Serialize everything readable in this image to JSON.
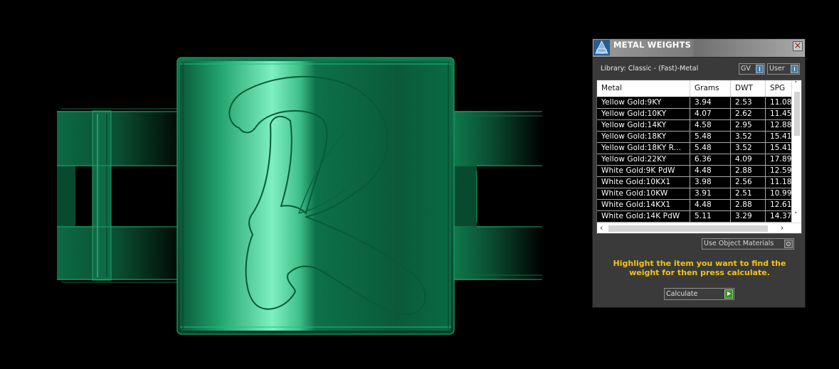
{
  "dialog": {
    "title": "METAL WEIGHTS",
    "close_label": "×",
    "library_label": "Library: Classic - (Fast)-Metal",
    "toggles": {
      "gv": "GV",
      "user": "User"
    },
    "columns": [
      "Metal",
      "Grams",
      "DWT",
      "SPG"
    ],
    "rows": [
      {
        "metal": "Yellow Gold:9KY",
        "grams": "3.94",
        "dwt": "2.53",
        "spg": "11.08"
      },
      {
        "metal": "Yellow Gold:10KY",
        "grams": "4.07",
        "dwt": "2.62",
        "spg": "11.45"
      },
      {
        "metal": "Yellow Gold:14KY",
        "grams": "4.58",
        "dwt": "2.95",
        "spg": "12.88"
      },
      {
        "metal": "Yellow Gold:18KY",
        "grams": "5.48",
        "dwt": "3.52",
        "spg": "15.41"
      },
      {
        "metal": "Yellow Gold:18KY R...",
        "grams": "5.48",
        "dwt": "3.52",
        "spg": "15.41"
      },
      {
        "metal": "Yellow Gold:22KY",
        "grams": "6.36",
        "dwt": "4.09",
        "spg": "17.89"
      },
      {
        "metal": "White Gold:9K PdW",
        "grams": "4.48",
        "dwt": "2.88",
        "spg": "12.59"
      },
      {
        "metal": "White Gold:10KX1",
        "grams": "3.98",
        "dwt": "2.56",
        "spg": "11.18"
      },
      {
        "metal": "White Gold:10KW",
        "grams": "3.91",
        "dwt": "2.51",
        "spg": "10.99"
      },
      {
        "metal": "White Gold:14KX1",
        "grams": "4.48",
        "dwt": "2.88",
        "spg": "12.61"
      },
      {
        "metal": "White Gold:14K PdW",
        "grams": "5.11",
        "dwt": "3.29",
        "spg": "14.37"
      }
    ],
    "use_materials_label": "Use Object Materials",
    "instructions": "Highlight the item you want to find the weight for then press calculate.",
    "calculate_label": "Calculate"
  },
  "colors": {
    "ring_green": "#0f8a55",
    "highlight_green": "#7ff0c0",
    "instructions_yellow": "#f0c419"
  }
}
